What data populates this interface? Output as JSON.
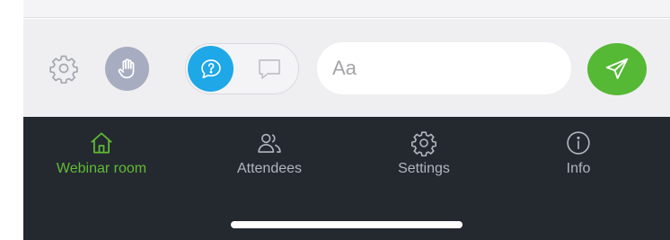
{
  "chat_bar": {
    "input_placeholder": "Aa",
    "gear_icon": "gear-icon",
    "raise_hand_icon": "hand-icon",
    "toggle": {
      "active_icon": "question-bubble-icon",
      "inactive_icon": "chat-bubble-icon"
    },
    "send_icon": "send-icon"
  },
  "tabs": [
    {
      "label": "Webinar room",
      "icon": "home-icon",
      "active": true
    },
    {
      "label": "Attendees",
      "icon": "people-icon",
      "active": false
    },
    {
      "label": "Settings",
      "icon": "gear-icon",
      "active": false
    },
    {
      "label": "Info",
      "icon": "info-icon",
      "active": false
    }
  ],
  "colors": {
    "accent_green": "#55b935",
    "active_tab_green": "#60bb35",
    "toggle_blue": "#1fa8e8",
    "hand_button": "#a7acc0",
    "tabbar_bg": "#242930",
    "tab_label": "#b2b5bd"
  }
}
